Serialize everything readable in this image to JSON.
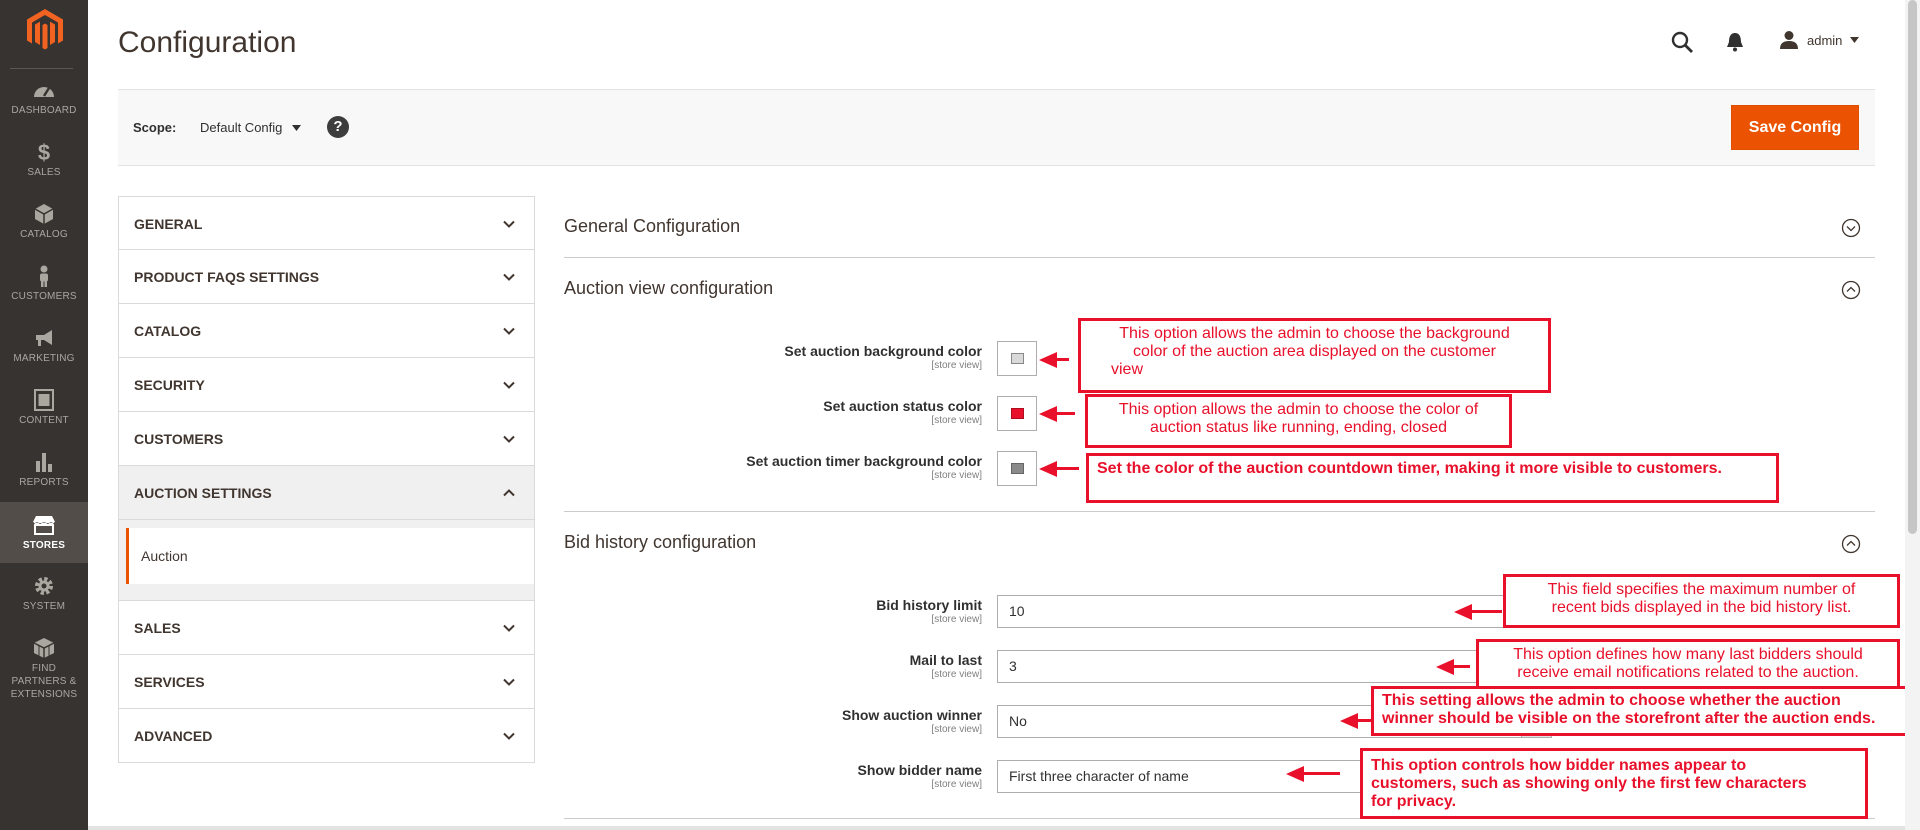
{
  "sidebar": {
    "items": [
      {
        "label": "DASHBOARD",
        "icon": "dashboard-icon"
      },
      {
        "label": "SALES",
        "icon": "dollar-icon"
      },
      {
        "label": "CATALOG",
        "icon": "cube-icon"
      },
      {
        "label": "CUSTOMERS",
        "icon": "person-icon"
      },
      {
        "label": "MARKETING",
        "icon": "megaphone-icon"
      },
      {
        "label": "CONTENT",
        "icon": "content-icon"
      },
      {
        "label": "REPORTS",
        "icon": "bar-chart-icon"
      },
      {
        "label": "STORES",
        "icon": "store-icon"
      },
      {
        "label": "SYSTEM",
        "icon": "gear-icon"
      },
      {
        "label": "FIND PARTNERS & EXTENSIONS",
        "icon": "boxes-icon"
      }
    ],
    "active": "STORES"
  },
  "header": {
    "title": "Configuration",
    "user": "admin"
  },
  "scope": {
    "label": "Scope:",
    "value": "Default Config",
    "help": "?"
  },
  "toolbar": {
    "save_label": "Save Config"
  },
  "tabs": {
    "general": "GENERAL",
    "product_faqs": "PRODUCT FAQS SETTINGS",
    "catalog": "CATALOG",
    "security": "SECURITY",
    "customers": "CUSTOMERS",
    "auction_settings": "AUCTION SETTINGS",
    "auction": "Auction",
    "sales": "SALES",
    "services": "SERVICES",
    "advanced": "ADVANCED"
  },
  "sections": {
    "general": "General Configuration",
    "auction_view": "Auction view configuration",
    "bid_history": "Bid history configuration"
  },
  "fields": {
    "scope_text": "[store view]",
    "bg_color": "Set auction background color",
    "status_color": "Set auction status color",
    "timer_color": "Set auction timer background color",
    "bid_limit": "Bid history limit",
    "bid_limit_value": "10",
    "mail_to_last": "Mail to last",
    "mail_to_last_value": "3",
    "show_winner": "Show auction winner",
    "show_winner_value": "No",
    "show_bidder": "Show bidder name",
    "show_bidder_value": "First three character of name"
  },
  "colors": {
    "bg_swatch": "#d9d9d9",
    "status_swatch": "#e8102a",
    "timer_swatch": "#8a8a8a",
    "accent": "#eb5202",
    "annotation": "#e8102a"
  },
  "annotations": {
    "bg_color_line1": "This option allows the admin to choose the background",
    "bg_color_line2": "color of the auction area displayed on the",
    "bg_color_line2b": "customer",
    "bg_color_line3": "view",
    "status_color_line1": "This option allows the admin to choose the color of",
    "status_color_line2": "auction status like running, ending, closed",
    "timer_color": "Set the color of the auction countdown timer, making it more visible to customers.",
    "bid_limit_line1": "This field specifies the maximum number of",
    "bid_limit_line2": "recent bids displayed in the bid history list.",
    "mail_to_last_line1": "This option defines how many last bidders should",
    "mail_to_last_line2": "receive email notifications related to the auction.",
    "show_winner_line1": "This setting allows the admin to choose whether the auction",
    "show_winner_line2": "winner should be visible on the storefront after the auction ends.",
    "show_bidder_line1": "This option controls how bidder names appear to",
    "show_bidder_line2": "customers, such as showing only the first few characters",
    "show_bidder_line3": "for privacy."
  }
}
